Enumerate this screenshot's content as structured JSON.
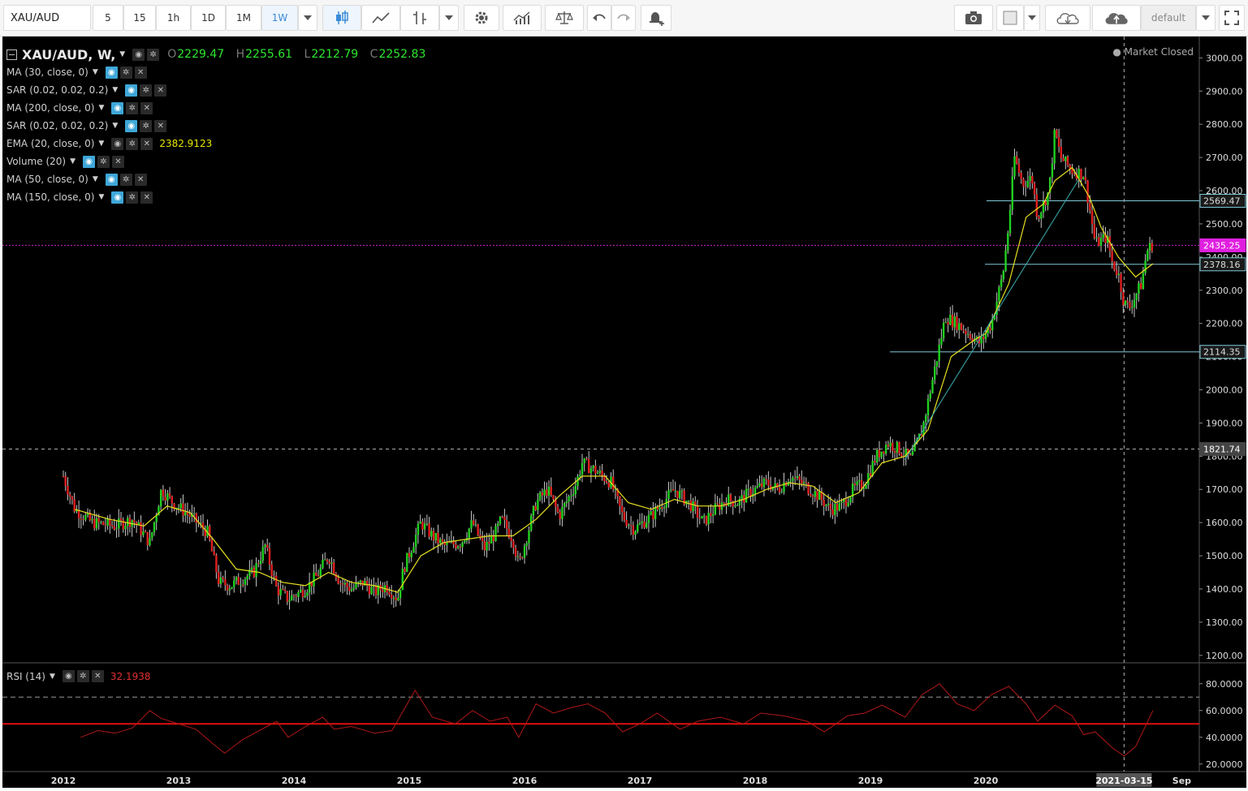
{
  "toolbar": {
    "symbol": "XAU/AUD",
    "intervals": [
      "5",
      "15",
      "1h",
      "1D",
      "1M",
      "1W"
    ],
    "active_interval": "1W",
    "layout_name": "default"
  },
  "legend": {
    "symbol_title": "XAU/AUD, W,",
    "open_label": "O",
    "open": "2229.47",
    "high_label": "H",
    "high": "2255.61",
    "low_label": "L",
    "low": "2212.79",
    "close_label": "C",
    "close": "2252.83",
    "indicators": [
      {
        "label": "MA (30, close, 0)",
        "on": true,
        "value": ""
      },
      {
        "label": "SAR (0.02, 0.02, 0.2)",
        "on": true,
        "value": ""
      },
      {
        "label": "MA (200, close, 0)",
        "on": true,
        "value": ""
      },
      {
        "label": "SAR (0.02, 0.02, 0.2)",
        "on": true,
        "value": ""
      },
      {
        "label": "EMA (20, close, 0)",
        "on": false,
        "value": "2382.9123"
      },
      {
        "label": "Volume (20)",
        "on": true,
        "value": ""
      },
      {
        "label": "MA (50, close, 0)",
        "on": true,
        "value": ""
      },
      {
        "label": "MA (150, close, 0)",
        "on": true,
        "value": ""
      }
    ],
    "market_status": "Market Closed"
  },
  "rsi": {
    "label": "RSI (14)",
    "value": "32.1938"
  },
  "chart_data": {
    "type": "candlestick",
    "price_axis": {
      "ticks": [
        "3000.00",
        "2900.00",
        "2800.00",
        "2700.00",
        "2600.00",
        "2500.00",
        "2400.00",
        "2300.00",
        "2200.00",
        "2100.00",
        "2000.00",
        "1900.00",
        "1800.00",
        "1700.00",
        "1600.00",
        "1500.00",
        "1400.00",
        "1300.00",
        "1200.00"
      ],
      "range": [
        1180,
        3040
      ]
    },
    "time_axis": {
      "labels": [
        "2012",
        "2013",
        "2014",
        "2015",
        "2016",
        "2017",
        "2018",
        "2019",
        "2020",
        "2021-03-15",
        "Sep"
      ],
      "crosshair_date": "2021-03-15"
    },
    "price_labels": [
      {
        "value": "2569.47",
        "kind": "level"
      },
      {
        "value": "2435.25",
        "kind": "current"
      },
      {
        "value": "2378.16",
        "kind": "level"
      },
      {
        "value": "2114.35",
        "kind": "level"
      },
      {
        "value": "1821.74",
        "kind": "crosshair"
      }
    ],
    "close_series": [
      [
        2012.0,
        1740
      ],
      [
        2012.1,
        1640
      ],
      [
        2012.25,
        1600
      ],
      [
        2012.45,
        1590
      ],
      [
        2012.6,
        1610
      ],
      [
        2012.75,
        1540
      ],
      [
        2012.85,
        1700
      ],
      [
        2012.95,
        1660
      ],
      [
        2013.1,
        1620
      ],
      [
        2013.25,
        1570
      ],
      [
        2013.35,
        1420
      ],
      [
        2013.45,
        1410
      ],
      [
        2013.55,
        1430
      ],
      [
        2013.65,
        1450
      ],
      [
        2013.75,
        1530
      ],
      [
        2013.85,
        1400
      ],
      [
        2013.95,
        1370
      ],
      [
        2014.1,
        1400
      ],
      [
        2014.2,
        1440
      ],
      [
        2014.3,
        1500
      ],
      [
        2014.4,
        1420
      ],
      [
        2014.5,
        1400
      ],
      [
        2014.6,
        1420
      ],
      [
        2014.7,
        1390
      ],
      [
        2014.8,
        1410
      ],
      [
        2014.9,
        1370
      ],
      [
        2014.95,
        1460
      ],
      [
        2015.1,
        1600
      ],
      [
        2015.2,
        1560
      ],
      [
        2015.3,
        1530
      ],
      [
        2015.45,
        1540
      ],
      [
        2015.55,
        1600
      ],
      [
        2015.65,
        1520
      ],
      [
        2015.75,
        1570
      ],
      [
        2015.8,
        1610
      ],
      [
        2015.9,
        1550
      ],
      [
        2015.95,
        1470
      ],
      [
        2016.1,
        1660
      ],
      [
        2016.2,
        1700
      ],
      [
        2016.3,
        1620
      ],
      [
        2016.45,
        1720
      ],
      [
        2016.5,
        1780
      ],
      [
        2016.6,
        1760
      ],
      [
        2016.75,
        1720
      ],
      [
        2016.85,
        1620
      ],
      [
        2016.95,
        1580
      ],
      [
        2017.1,
        1620
      ],
      [
        2017.2,
        1660
      ],
      [
        2017.3,
        1700
      ],
      [
        2017.45,
        1650
      ],
      [
        2017.55,
        1600
      ],
      [
        2017.65,
        1640
      ],
      [
        2017.75,
        1670
      ],
      [
        2017.85,
        1660
      ],
      [
        2017.95,
        1690
      ],
      [
        2018.1,
        1720
      ],
      [
        2018.2,
        1700
      ],
      [
        2018.3,
        1740
      ],
      [
        2018.4,
        1720
      ],
      [
        2018.55,
        1680
      ],
      [
        2018.65,
        1640
      ],
      [
        2018.75,
        1650
      ],
      [
        2018.85,
        1700
      ],
      [
        2018.95,
        1720
      ],
      [
        2019.05,
        1800
      ],
      [
        2019.15,
        1840
      ],
      [
        2019.25,
        1820
      ],
      [
        2019.35,
        1790
      ],
      [
        2019.45,
        1880
      ],
      [
        2019.55,
        2050
      ],
      [
        2019.65,
        2220
      ],
      [
        2019.75,
        2200
      ],
      [
        2019.85,
        2170
      ],
      [
        2019.95,
        2140
      ],
      [
        2020.05,
        2200
      ],
      [
        2020.15,
        2350
      ],
      [
        2020.2,
        2500
      ],
      [
        2020.25,
        2700
      ],
      [
        2020.32,
        2620
      ],
      [
        2020.4,
        2640
      ],
      [
        2020.45,
        2520
      ],
      [
        2020.5,
        2560
      ],
      [
        2020.55,
        2600
      ],
      [
        2020.6,
        2780
      ],
      [
        2020.65,
        2700
      ],
      [
        2020.75,
        2660
      ],
      [
        2020.85,
        2650
      ],
      [
        2020.9,
        2550
      ],
      [
        2020.95,
        2440
      ],
      [
        2021.05,
        2460
      ],
      [
        2021.1,
        2380
      ],
      [
        2021.15,
        2350
      ],
      [
        2021.2,
        2260
      ],
      [
        2021.25,
        2250
      ],
      [
        2021.35,
        2320
      ],
      [
        2021.4,
        2420
      ],
      [
        2021.45,
        2440
      ]
    ],
    "ema20": [
      [
        2012.1,
        1640
      ],
      [
        2012.4,
        1610
      ],
      [
        2012.7,
        1590
      ],
      [
        2012.9,
        1650
      ],
      [
        2013.1,
        1630
      ],
      [
        2013.3,
        1550
      ],
      [
        2013.5,
        1460
      ],
      [
        2013.7,
        1450
      ],
      [
        2013.9,
        1420
      ],
      [
        2014.1,
        1410
      ],
      [
        2014.3,
        1450
      ],
      [
        2014.5,
        1420
      ],
      [
        2014.7,
        1410
      ],
      [
        2014.9,
        1390
      ],
      [
        2015.1,
        1500
      ],
      [
        2015.3,
        1540
      ],
      [
        2015.5,
        1550
      ],
      [
        2015.7,
        1560
      ],
      [
        2015.9,
        1560
      ],
      [
        2016.1,
        1610
      ],
      [
        2016.3,
        1680
      ],
      [
        2016.5,
        1740
      ],
      [
        2016.7,
        1740
      ],
      [
        2016.9,
        1660
      ],
      [
        2017.1,
        1640
      ],
      [
        2017.3,
        1670
      ],
      [
        2017.5,
        1650
      ],
      [
        2017.7,
        1650
      ],
      [
        2017.9,
        1670
      ],
      [
        2018.1,
        1700
      ],
      [
        2018.3,
        1720
      ],
      [
        2018.5,
        1710
      ],
      [
        2018.7,
        1660
      ],
      [
        2018.9,
        1690
      ],
      [
        2019.1,
        1780
      ],
      [
        2019.3,
        1800
      ],
      [
        2019.5,
        1880
      ],
      [
        2019.7,
        2100
      ],
      [
        2019.9,
        2150
      ],
      [
        2020.0,
        2170
      ],
      [
        2020.2,
        2320
      ],
      [
        2020.35,
        2520
      ],
      [
        2020.5,
        2560
      ],
      [
        2020.6,
        2630
      ],
      [
        2020.75,
        2670
      ],
      [
        2020.9,
        2580
      ],
      [
        2021.0,
        2490
      ],
      [
        2021.15,
        2400
      ],
      [
        2021.3,
        2340
      ],
      [
        2021.45,
        2380
      ]
    ],
    "trendline": [
      [
        2019.3,
        1790
      ],
      [
        2020.8,
        2630
      ]
    ],
    "rsi_axis": {
      "ticks": [
        "80.0000",
        "60.0000",
        "40.0000",
        "20.0000"
      ],
      "range": [
        15,
        95
      ]
    },
    "rsi_series": [
      [
        2012.15,
        40
      ],
      [
        2012.3,
        45
      ],
      [
        2012.45,
        43
      ],
      [
        2012.6,
        47
      ],
      [
        2012.75,
        60
      ],
      [
        2012.85,
        54
      ],
      [
        2013.0,
        50
      ],
      [
        2013.15,
        46
      ],
      [
        2013.3,
        35
      ],
      [
        2013.4,
        28
      ],
      [
        2013.55,
        38
      ],
      [
        2013.7,
        45
      ],
      [
        2013.85,
        52
      ],
      [
        2013.95,
        40
      ],
      [
        2014.1,
        48
      ],
      [
        2014.25,
        55
      ],
      [
        2014.35,
        46
      ],
      [
        2014.5,
        48
      ],
      [
        2014.7,
        43
      ],
      [
        2014.85,
        45
      ],
      [
        2014.95,
        60
      ],
      [
        2015.05,
        75
      ],
      [
        2015.2,
        55
      ],
      [
        2015.4,
        50
      ],
      [
        2015.55,
        60
      ],
      [
        2015.7,
        52
      ],
      [
        2015.85,
        55
      ],
      [
        2015.95,
        40
      ],
      [
        2016.1,
        65
      ],
      [
        2016.25,
        58
      ],
      [
        2016.4,
        62
      ],
      [
        2016.55,
        65
      ],
      [
        2016.7,
        58
      ],
      [
        2016.85,
        44
      ],
      [
        2017.0,
        50
      ],
      [
        2017.15,
        58
      ],
      [
        2017.35,
        46
      ],
      [
        2017.5,
        52
      ],
      [
        2017.7,
        55
      ],
      [
        2017.9,
        50
      ],
      [
        2018.05,
        58
      ],
      [
        2018.25,
        56
      ],
      [
        2018.45,
        52
      ],
      [
        2018.6,
        44
      ],
      [
        2018.8,
        56
      ],
      [
        2018.95,
        58
      ],
      [
        2019.1,
        64
      ],
      [
        2019.3,
        55
      ],
      [
        2019.45,
        72
      ],
      [
        2019.6,
        80
      ],
      [
        2019.75,
        65
      ],
      [
        2019.9,
        60
      ],
      [
        2020.05,
        72
      ],
      [
        2020.2,
        78
      ],
      [
        2020.35,
        65
      ],
      [
        2020.45,
        52
      ],
      [
        2020.6,
        64
      ],
      [
        2020.75,
        56
      ],
      [
        2020.85,
        42
      ],
      [
        2020.95,
        44
      ],
      [
        2021.1,
        32
      ],
      [
        2021.2,
        26
      ],
      [
        2021.3,
        33
      ],
      [
        2021.45,
        60
      ]
    ],
    "rsi_upper": "70",
    "rsi_mid": "50"
  }
}
